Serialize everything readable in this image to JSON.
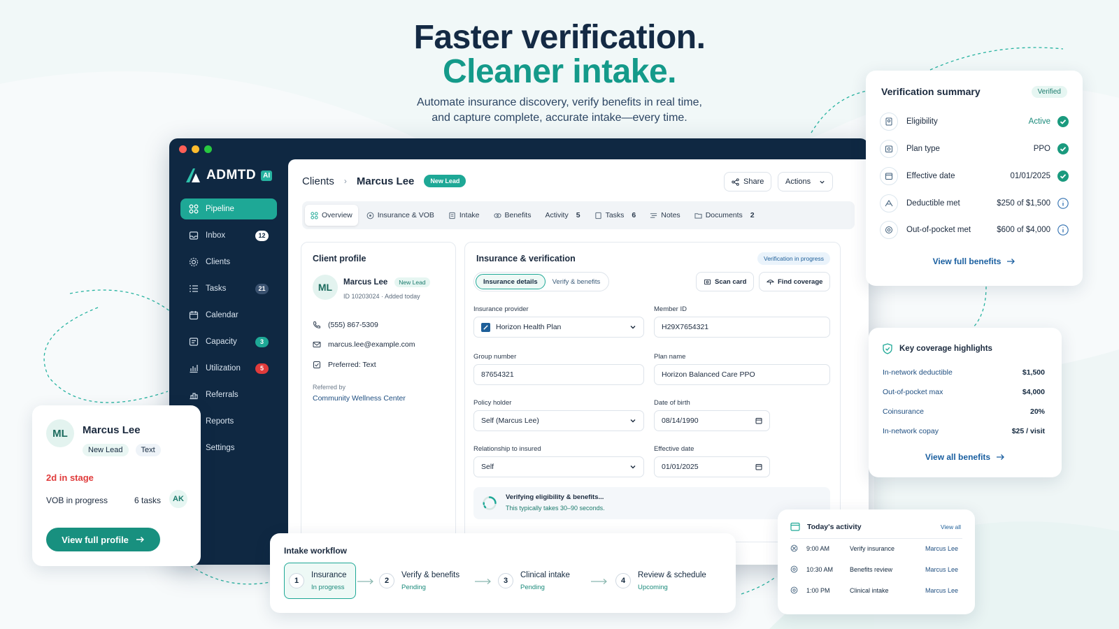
{
  "hero": {
    "title_line1": "Faster verification.",
    "title_line2": "Cleaner intake.",
    "subtitle_line1": "Automate insurance discovery, verify benefits in real time,",
    "subtitle_line2": "and capture complete, accurate intake—every time."
  },
  "colors": {
    "accent": "#1ea896",
    "navy": "#0f2842",
    "link": "#1a5fa0",
    "danger": "#e03b3b"
  },
  "brand": {
    "name": "ADMTD",
    "badge": "AI"
  },
  "sidebar": {
    "items": [
      {
        "label": "Pipeline",
        "icon": "pipeline-icon",
        "badge": ""
      },
      {
        "label": "Inbox",
        "icon": "inbox-icon",
        "badge": "12"
      },
      {
        "label": "Clients",
        "icon": "clients-icon",
        "badge": ""
      },
      {
        "label": "Tasks",
        "icon": "tasks-icon",
        "badge": "21"
      },
      {
        "label": "Calendar",
        "icon": "calendar-icon",
        "badge": ""
      },
      {
        "label": "Capacity",
        "icon": "capacity-icon",
        "badge": "3"
      },
      {
        "label": "Utilization",
        "icon": "utilization-icon",
        "badge": "5"
      },
      {
        "label": "Referrals",
        "icon": "referrals-icon",
        "badge": ""
      },
      {
        "label": "Reports",
        "icon": "reports-icon",
        "badge": ""
      },
      {
        "label": "Settings",
        "icon": "settings-icon",
        "badge": ""
      }
    ]
  },
  "header": {
    "crumb_root": "Clients",
    "crumb_name": "Marcus Lee",
    "status": "New Lead",
    "share": "Share",
    "actions": "Actions"
  },
  "tabs": [
    {
      "label": "Overview",
      "count": ""
    },
    {
      "label": "Insurance & VOB",
      "count": ""
    },
    {
      "label": "Intake",
      "count": ""
    },
    {
      "label": "Benefits",
      "count": ""
    },
    {
      "label": "Activity",
      "count": "5"
    },
    {
      "label": "Tasks",
      "count": "6"
    },
    {
      "label": "Notes",
      "count": ""
    },
    {
      "label": "Documents",
      "count": "2"
    }
  ],
  "profile": {
    "title": "Client profile",
    "initials": "ML",
    "name": "Marcus Lee",
    "status": "New Lead",
    "id_line": "ID 10203024 · Added today",
    "phone": "(555) 867-5309",
    "email": "marcus.lee@example.com",
    "preferred": "Preferred: Text",
    "referred_label": "Referred by",
    "referred_value": "Community Wellness Center"
  },
  "insurance": {
    "title": "Insurance & verification",
    "status": "Verification in progress",
    "seg_details": "Insurance details",
    "seg_verify": "Verify & benefits",
    "scan_card": "Scan card",
    "find_coverage": "Find coverage",
    "provider_label": "Insurance provider",
    "provider_value": "Horizon Health Plan",
    "member_label": "Member ID",
    "member_value": "H29X7654321",
    "group_label": "Group number",
    "group_value": "87654321",
    "plan_label": "Plan name",
    "plan_value": "Horizon Balanced Care PPO",
    "holder_label": "Policy holder",
    "holder_value": "Self (Marcus Lee)",
    "dob_label": "Date of birth",
    "dob_value": "08/14/1990",
    "rel_label": "Relationship to insured",
    "rel_value": "Self",
    "eff_label": "Effective date",
    "eff_value": "01/01/2025",
    "verifying_title": "Verifying eligibility & benefits...",
    "verifying_sub": "This typically takes 30–90 seconds."
  },
  "verification_summary": {
    "title": "Verification summary",
    "badge": "Verified",
    "rows": [
      {
        "label": "Eligibility",
        "value": "Active",
        "status": "check"
      },
      {
        "label": "Plan type",
        "value": "PPO",
        "status": "check"
      },
      {
        "label": "Effective date",
        "value": "01/01/2025",
        "status": "check"
      },
      {
        "label": "Deductible met",
        "value": "$250 of $1,500",
        "status": "info"
      },
      {
        "label": "Out-of-pocket met",
        "value": "$600 of $4,000",
        "status": "info"
      }
    ],
    "link": "View full benefits"
  },
  "coverage": {
    "title": "Key coverage highlights",
    "rows": [
      {
        "label": "In-network deductible",
        "value": "$1,500"
      },
      {
        "label": "Out-of-pocket max",
        "value": "$4,000"
      },
      {
        "label": "Coinsurance",
        "value": "20%"
      },
      {
        "label": "In-network copay",
        "value": "$25 / visit"
      }
    ],
    "link": "View all benefits"
  },
  "mini_card": {
    "initials": "ML",
    "name": "Marcus Lee",
    "tag1": "New Lead",
    "tag2": "Text",
    "stage": "2d in stage",
    "vob": "VOB in progress",
    "tasks": "6 tasks",
    "assignee": "AK",
    "button": "View full profile"
  },
  "workflow": {
    "title": "Intake workflow",
    "steps": [
      {
        "num": "1",
        "title": "Insurance",
        "status": "In progress"
      },
      {
        "num": "2",
        "title": "Verify & benefits",
        "status": "Pending"
      },
      {
        "num": "3",
        "title": "Clinical intake",
        "status": "Pending"
      },
      {
        "num": "4",
        "title": "Review & schedule",
        "status": "Upcoming"
      }
    ]
  },
  "activity": {
    "title": "Today's activity",
    "view_all": "View all",
    "rows": [
      {
        "time": "9:00 AM",
        "task": "Verify insurance",
        "who": "Marcus Lee"
      },
      {
        "time": "10:30 AM",
        "task": "Benefits review",
        "who": "Marcus Lee"
      },
      {
        "time": "1:00 PM",
        "task": "Clinical intake",
        "who": "Marcus Lee"
      }
    ]
  }
}
